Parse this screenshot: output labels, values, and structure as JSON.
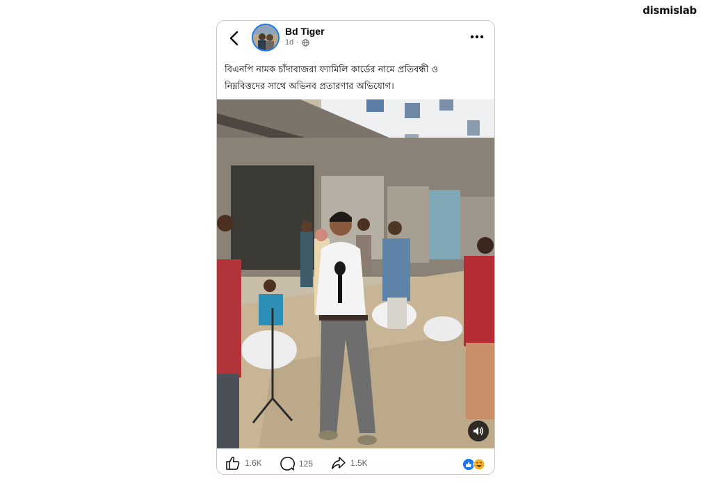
{
  "brand": {
    "logo_text": "dismislab"
  },
  "post": {
    "author": "Bd Tiger",
    "time": "1d",
    "separator": "·",
    "caption_line1": "বিএনপি নামক চাঁদাবাজরা ফ্যামিলি কার্ডের নামে প্রতিবন্ধী ও",
    "caption_line2": "নিম্নবিত্তদের সাথে অভিনব প্রতারণার অভিযোগ।",
    "likes": "1.6K",
    "comments": "125",
    "shares": "1.5K"
  },
  "colors": {
    "accent": "#1877f2",
    "reaction_love": "#f33e58",
    "reaction_haha": "#f7b125"
  },
  "icons": {
    "back": "chevron-left-icon",
    "more": "ellipsis-icon",
    "audience": "globe-icon",
    "like": "thumbs-up-icon",
    "comment": "comment-bubble-icon",
    "share": "share-arrow-icon",
    "sound": "speaker-icon"
  }
}
